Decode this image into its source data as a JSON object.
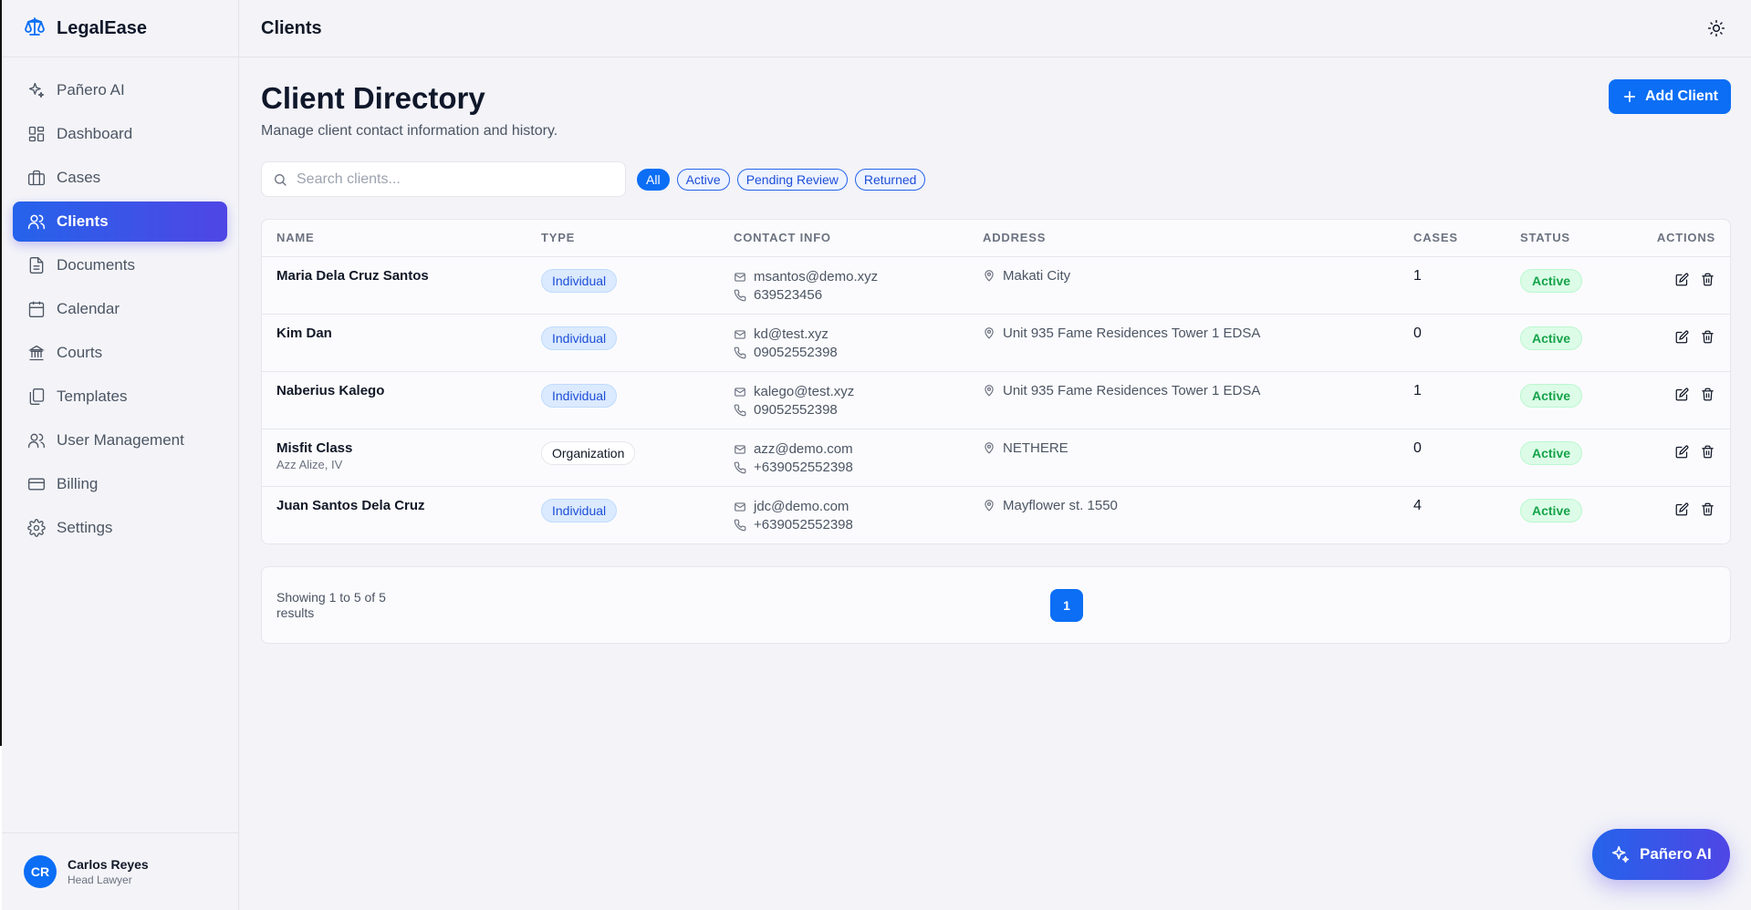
{
  "brand": {
    "name": "LegalEase"
  },
  "sidebar": {
    "items": [
      {
        "label": "Pañero AI",
        "icon": "sparkles-icon"
      },
      {
        "label": "Dashboard",
        "icon": "dashboard-icon"
      },
      {
        "label": "Cases",
        "icon": "briefcase-icon"
      },
      {
        "label": "Clients",
        "icon": "users-icon",
        "active": true
      },
      {
        "label": "Documents",
        "icon": "document-icon"
      },
      {
        "label": "Calendar",
        "icon": "calendar-icon"
      },
      {
        "label": "Courts",
        "icon": "courthouse-icon"
      },
      {
        "label": "Templates",
        "icon": "templates-icon"
      },
      {
        "label": "User Management",
        "icon": "user-management-icon"
      },
      {
        "label": "Billing",
        "icon": "credit-card-icon"
      },
      {
        "label": "Settings",
        "icon": "gear-icon"
      }
    ],
    "user": {
      "initials": "CR",
      "name": "Carlos Reyes",
      "role": "Head Lawyer"
    }
  },
  "topbar": {
    "title": "Clients"
  },
  "page": {
    "title": "Client Directory",
    "subtitle": "Manage client contact information and history.",
    "add_label": "Add Client"
  },
  "search": {
    "placeholder": "Search clients...",
    "value": ""
  },
  "filters": [
    {
      "label": "All",
      "active": true
    },
    {
      "label": "Active"
    },
    {
      "label": "Pending Review"
    },
    {
      "label": "Returned"
    }
  ],
  "table": {
    "columns": [
      "NAME",
      "TYPE",
      "CONTACT INFO",
      "ADDRESS",
      "CASES",
      "STATUS",
      "ACTIONS"
    ],
    "rows": [
      {
        "name": "Maria Dela Cruz Santos",
        "sub": "",
        "type": "Individual",
        "email": "msantos@demo.xyz",
        "phone": "639523456",
        "address": "Makati City",
        "cases": "1",
        "status": "Active"
      },
      {
        "name": "Kim Dan",
        "sub": "",
        "type": "Individual",
        "email": "kd@test.xyz",
        "phone": "09052552398",
        "address": "Unit 935 Fame Residences Tower 1 EDSA",
        "cases": "0",
        "status": "Active"
      },
      {
        "name": "Naberius Kalego",
        "sub": "",
        "type": "Individual",
        "email": "kalego@test.xyz",
        "phone": "09052552398",
        "address": "Unit 935 Fame Residences Tower 1 EDSA",
        "cases": "1",
        "status": "Active"
      },
      {
        "name": "Misfit Class",
        "sub": "Azz Alize, IV",
        "type": "Organization",
        "email": "azz@demo.com",
        "phone": "+639052552398",
        "address": "NETHERE",
        "cases": "0",
        "status": "Active"
      },
      {
        "name": "Juan Santos Dela Cruz",
        "sub": "",
        "type": "Individual",
        "email": "jdc@demo.com",
        "phone": "+639052552398",
        "address": "Mayflower st. 1550",
        "cases": "4",
        "status": "Active"
      }
    ]
  },
  "pagination": {
    "summary": "Showing 1 to 5 of 5 results",
    "current_page": "1"
  },
  "fab": {
    "label": "Pañero AI"
  },
  "colors": {
    "primary": "#0b6ef5",
    "accent": "#4f46e5",
    "success": "#16a34a"
  }
}
